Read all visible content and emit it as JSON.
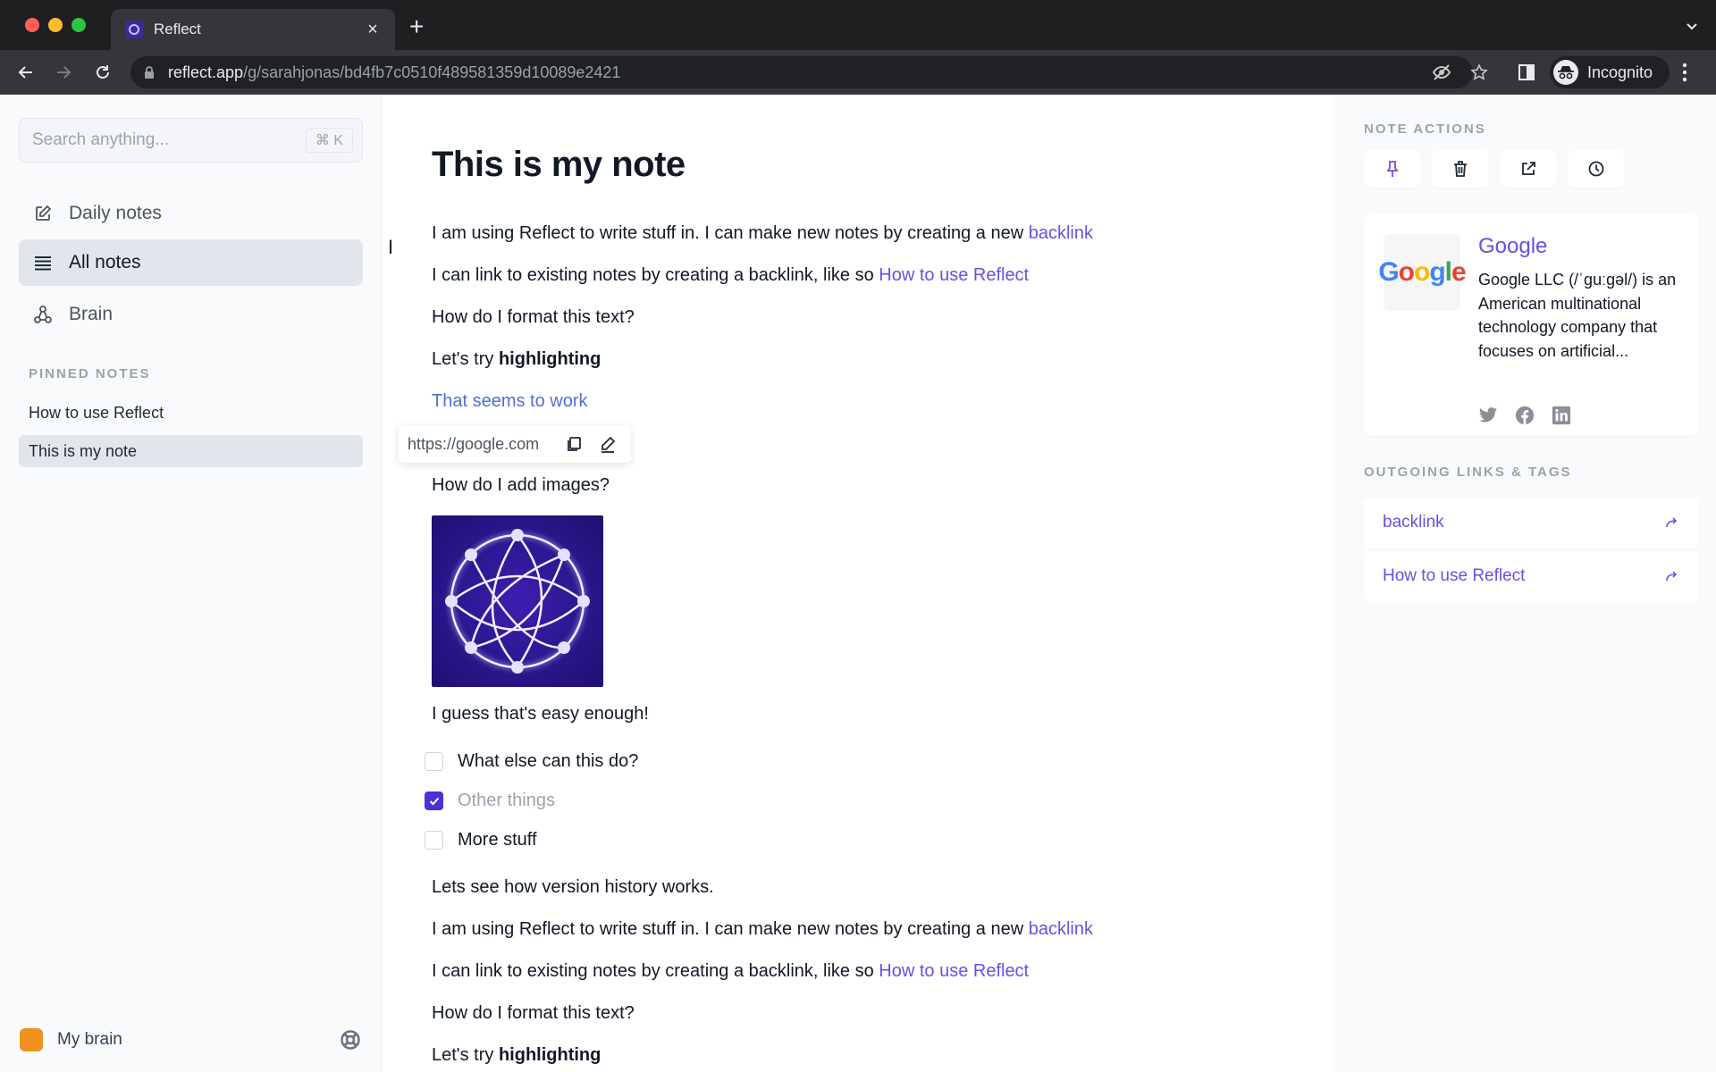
{
  "browser": {
    "tab_title": "Reflect",
    "url_host": "reflect.app",
    "url_path": "/g/sarahjonas/bd4fb7c0510f489581359d10089e2421",
    "profile_label": "Incognito"
  },
  "sidebar": {
    "search_placeholder": "Search anything...",
    "search_shortcut": "⌘ K",
    "nav": [
      {
        "label": "Daily notes",
        "icon": "edit-icon",
        "active": false
      },
      {
        "label": "All notes",
        "icon": "list-icon",
        "active": true
      },
      {
        "label": "Brain",
        "icon": "graph-icon",
        "active": false
      }
    ],
    "pinned_heading": "PINNED NOTES",
    "pinned": [
      {
        "label": "How to use Reflect",
        "active": false
      },
      {
        "label": "This is my note",
        "active": true
      }
    ],
    "brain_name": "My brain",
    "brain_color": "#f0901e"
  },
  "note": {
    "title": "This is my note",
    "p1_text": "I am using Reflect to write stuff in. I can make new notes by creating a new ",
    "p1_link": "backlink",
    "p2_text": "I can link to existing notes by creating a backlink, like so ",
    "p2_link": "How to use Reflect",
    "p3": "How do I format this text?",
    "p4_text": "Let's try ",
    "p4_bold": "highlighting",
    "p5_link": "That seems to work",
    "popover_url": "https://google.com",
    "p6": "How do I add images?",
    "p7": "I guess that's easy enough!",
    "todos": [
      {
        "text": "What else can this do?",
        "checked": false
      },
      {
        "text": "Other things",
        "checked": true
      },
      {
        "text": "More stuff",
        "checked": false
      }
    ],
    "p8": "Lets see how version history works.",
    "p9_text": "I am using Reflect to write stuff in. I can make new notes by creating a new ",
    "p9_link": "backlink",
    "p10_text": "I can link to existing notes by creating a backlink, like so ",
    "p10_link": "How to use Reflect",
    "p11": "How do I format this text?",
    "p12_text": "Let's try ",
    "p12_bold": "highlighting"
  },
  "right_panel": {
    "actions_heading": "NOTE ACTIONS",
    "actions": [
      "pin",
      "delete",
      "open-external",
      "version-history"
    ],
    "preview": {
      "title": "Google",
      "logo_text": "Google",
      "description": "Google LLC (/ˈɡuːɡəl/) is an American multinational technology company that focuses on artificial...",
      "socials": [
        "twitter",
        "facebook",
        "linkedin"
      ]
    },
    "links_heading": "OUTGOING LINKS & TAGS",
    "links": [
      {
        "label": "backlink"
      },
      {
        "label": "How to use Reflect"
      }
    ]
  },
  "colors": {
    "accent": "#6d4ee6",
    "checkbox": "#4c31d6",
    "link_blue": "#4f6fdb"
  }
}
